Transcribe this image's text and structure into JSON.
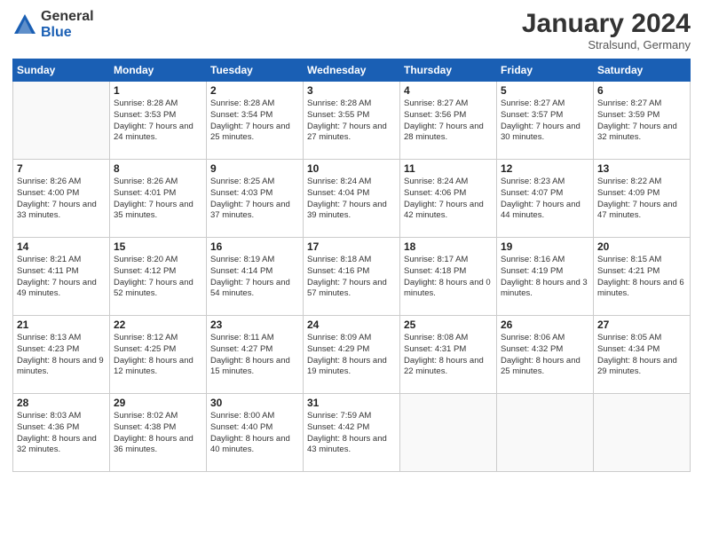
{
  "logo": {
    "general": "General",
    "blue": "Blue"
  },
  "title": "January 2024",
  "location": "Stralsund, Germany",
  "days_of_week": [
    "Sunday",
    "Monday",
    "Tuesday",
    "Wednesday",
    "Thursday",
    "Friday",
    "Saturday"
  ],
  "weeks": [
    [
      {
        "day": "",
        "sunrise": "",
        "sunset": "",
        "daylight": ""
      },
      {
        "day": "1",
        "sunrise": "Sunrise: 8:28 AM",
        "sunset": "Sunset: 3:53 PM",
        "daylight": "Daylight: 7 hours and 24 minutes."
      },
      {
        "day": "2",
        "sunrise": "Sunrise: 8:28 AM",
        "sunset": "Sunset: 3:54 PM",
        "daylight": "Daylight: 7 hours and 25 minutes."
      },
      {
        "day": "3",
        "sunrise": "Sunrise: 8:28 AM",
        "sunset": "Sunset: 3:55 PM",
        "daylight": "Daylight: 7 hours and 27 minutes."
      },
      {
        "day": "4",
        "sunrise": "Sunrise: 8:27 AM",
        "sunset": "Sunset: 3:56 PM",
        "daylight": "Daylight: 7 hours and 28 minutes."
      },
      {
        "day": "5",
        "sunrise": "Sunrise: 8:27 AM",
        "sunset": "Sunset: 3:57 PM",
        "daylight": "Daylight: 7 hours and 30 minutes."
      },
      {
        "day": "6",
        "sunrise": "Sunrise: 8:27 AM",
        "sunset": "Sunset: 3:59 PM",
        "daylight": "Daylight: 7 hours and 32 minutes."
      }
    ],
    [
      {
        "day": "7",
        "sunrise": "Sunrise: 8:26 AM",
        "sunset": "Sunset: 4:00 PM",
        "daylight": "Daylight: 7 hours and 33 minutes."
      },
      {
        "day": "8",
        "sunrise": "Sunrise: 8:26 AM",
        "sunset": "Sunset: 4:01 PM",
        "daylight": "Daylight: 7 hours and 35 minutes."
      },
      {
        "day": "9",
        "sunrise": "Sunrise: 8:25 AM",
        "sunset": "Sunset: 4:03 PM",
        "daylight": "Daylight: 7 hours and 37 minutes."
      },
      {
        "day": "10",
        "sunrise": "Sunrise: 8:24 AM",
        "sunset": "Sunset: 4:04 PM",
        "daylight": "Daylight: 7 hours and 39 minutes."
      },
      {
        "day": "11",
        "sunrise": "Sunrise: 8:24 AM",
        "sunset": "Sunset: 4:06 PM",
        "daylight": "Daylight: 7 hours and 42 minutes."
      },
      {
        "day": "12",
        "sunrise": "Sunrise: 8:23 AM",
        "sunset": "Sunset: 4:07 PM",
        "daylight": "Daylight: 7 hours and 44 minutes."
      },
      {
        "day": "13",
        "sunrise": "Sunrise: 8:22 AM",
        "sunset": "Sunset: 4:09 PM",
        "daylight": "Daylight: 7 hours and 47 minutes."
      }
    ],
    [
      {
        "day": "14",
        "sunrise": "Sunrise: 8:21 AM",
        "sunset": "Sunset: 4:11 PM",
        "daylight": "Daylight: 7 hours and 49 minutes."
      },
      {
        "day": "15",
        "sunrise": "Sunrise: 8:20 AM",
        "sunset": "Sunset: 4:12 PM",
        "daylight": "Daylight: 7 hours and 52 minutes."
      },
      {
        "day": "16",
        "sunrise": "Sunrise: 8:19 AM",
        "sunset": "Sunset: 4:14 PM",
        "daylight": "Daylight: 7 hours and 54 minutes."
      },
      {
        "day": "17",
        "sunrise": "Sunrise: 8:18 AM",
        "sunset": "Sunset: 4:16 PM",
        "daylight": "Daylight: 7 hours and 57 minutes."
      },
      {
        "day": "18",
        "sunrise": "Sunrise: 8:17 AM",
        "sunset": "Sunset: 4:18 PM",
        "daylight": "Daylight: 8 hours and 0 minutes."
      },
      {
        "day": "19",
        "sunrise": "Sunrise: 8:16 AM",
        "sunset": "Sunset: 4:19 PM",
        "daylight": "Daylight: 8 hours and 3 minutes."
      },
      {
        "day": "20",
        "sunrise": "Sunrise: 8:15 AM",
        "sunset": "Sunset: 4:21 PM",
        "daylight": "Daylight: 8 hours and 6 minutes."
      }
    ],
    [
      {
        "day": "21",
        "sunrise": "Sunrise: 8:13 AM",
        "sunset": "Sunset: 4:23 PM",
        "daylight": "Daylight: 8 hours and 9 minutes."
      },
      {
        "day": "22",
        "sunrise": "Sunrise: 8:12 AM",
        "sunset": "Sunset: 4:25 PM",
        "daylight": "Daylight: 8 hours and 12 minutes."
      },
      {
        "day": "23",
        "sunrise": "Sunrise: 8:11 AM",
        "sunset": "Sunset: 4:27 PM",
        "daylight": "Daylight: 8 hours and 15 minutes."
      },
      {
        "day": "24",
        "sunrise": "Sunrise: 8:09 AM",
        "sunset": "Sunset: 4:29 PM",
        "daylight": "Daylight: 8 hours and 19 minutes."
      },
      {
        "day": "25",
        "sunrise": "Sunrise: 8:08 AM",
        "sunset": "Sunset: 4:31 PM",
        "daylight": "Daylight: 8 hours and 22 minutes."
      },
      {
        "day": "26",
        "sunrise": "Sunrise: 8:06 AM",
        "sunset": "Sunset: 4:32 PM",
        "daylight": "Daylight: 8 hours and 25 minutes."
      },
      {
        "day": "27",
        "sunrise": "Sunrise: 8:05 AM",
        "sunset": "Sunset: 4:34 PM",
        "daylight": "Daylight: 8 hours and 29 minutes."
      }
    ],
    [
      {
        "day": "28",
        "sunrise": "Sunrise: 8:03 AM",
        "sunset": "Sunset: 4:36 PM",
        "daylight": "Daylight: 8 hours and 32 minutes."
      },
      {
        "day": "29",
        "sunrise": "Sunrise: 8:02 AM",
        "sunset": "Sunset: 4:38 PM",
        "daylight": "Daylight: 8 hours and 36 minutes."
      },
      {
        "day": "30",
        "sunrise": "Sunrise: 8:00 AM",
        "sunset": "Sunset: 4:40 PM",
        "daylight": "Daylight: 8 hours and 40 minutes."
      },
      {
        "day": "31",
        "sunrise": "Sunrise: 7:59 AM",
        "sunset": "Sunset: 4:42 PM",
        "daylight": "Daylight: 8 hours and 43 minutes."
      },
      {
        "day": "",
        "sunrise": "",
        "sunset": "",
        "daylight": ""
      },
      {
        "day": "",
        "sunrise": "",
        "sunset": "",
        "daylight": ""
      },
      {
        "day": "",
        "sunrise": "",
        "sunset": "",
        "daylight": ""
      }
    ]
  ]
}
